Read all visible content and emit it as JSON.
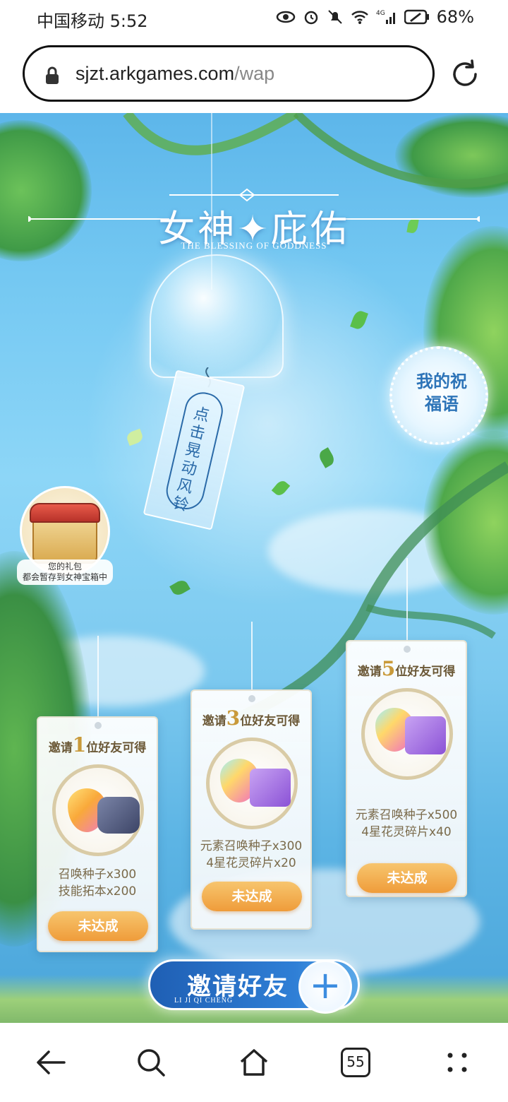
{
  "status_bar": {
    "carrier_time": "中国移动 5:52",
    "network": "4G",
    "battery": "68%"
  },
  "browser": {
    "url_domain": "sjzt.arkgames.com",
    "url_path": "/wap",
    "tabs_count": "55"
  },
  "page": {
    "title": "女神✦庇佑",
    "subtitle": "THE BLESSING OF GODDNESS",
    "bell_text": "点击晃动风铃",
    "blessing_button": "我的祝福语",
    "gift_label_line1": "您的礼包",
    "gift_label_line2": "都会暂存到女神宝箱中",
    "cards": [
      {
        "title_pre": "邀请",
        "title_num": "1",
        "title_post": "位好友可得",
        "item1": "召唤种子x300",
        "item2": "技能拓本x200",
        "button": "未达成"
      },
      {
        "title_pre": "邀请",
        "title_num": "3",
        "title_post": "位好友可得",
        "item1": "元素召唤种子x300",
        "item2": "4星花灵碎片x20",
        "button": "未达成"
      },
      {
        "title_pre": "邀请",
        "title_num": "5",
        "title_post": "位好友可得",
        "item1": "元素召唤种子x500",
        "item2": "4星花灵碎片x40",
        "button": "未达成"
      }
    ],
    "invite_button": "邀请好友",
    "invite_sub": "LI JI QI CHENG",
    "invite_plus": "+"
  },
  "icons": {
    "lock": "lock-icon",
    "refresh": "refresh-icon",
    "back": "back-arrow-icon",
    "search": "search-icon",
    "home": "home-icon",
    "tabs": "tabs-icon",
    "menu": "more-dots-icon"
  }
}
